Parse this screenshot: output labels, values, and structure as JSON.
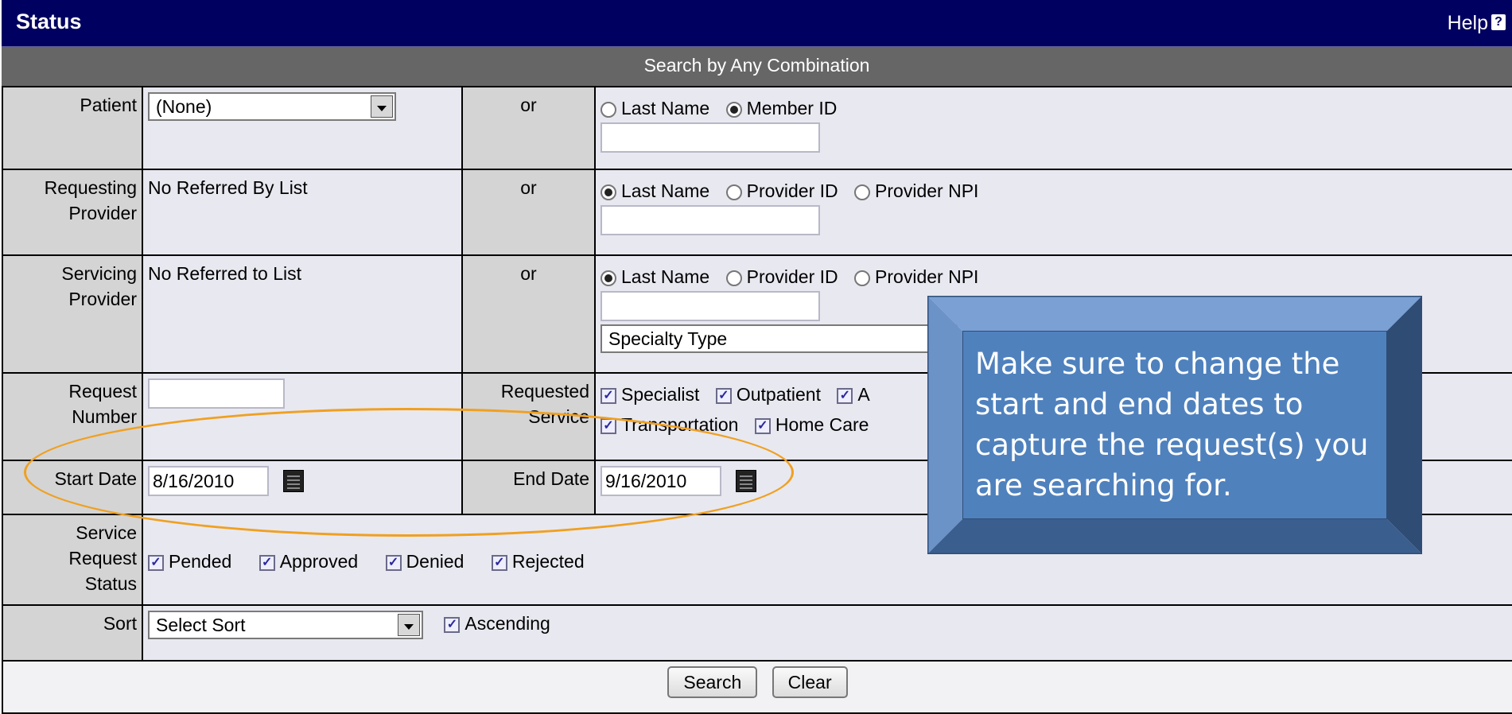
{
  "header": {
    "title": "Status",
    "help_label": "Help",
    "help_icon": "?"
  },
  "subheader": {
    "text": "Search by Any Combination"
  },
  "rows": {
    "patient": {
      "label": "Patient",
      "select_value": "(None)",
      "or": "or",
      "radios": [
        "Last Name",
        "Member ID"
      ],
      "selected": "Member ID"
    },
    "requesting": {
      "label_line1": "Requesting",
      "label_line2": "Provider",
      "value": "No Referred By List",
      "or": "or",
      "radios": [
        "Last Name",
        "Provider ID",
        "Provider NPI"
      ],
      "selected": "Last Name"
    },
    "servicing": {
      "label_line1": "Servicing",
      "label_line2": "Provider",
      "value": "No Referred to List",
      "or": "or",
      "radios": [
        "Last Name",
        "Provider ID",
        "Provider NPI"
      ],
      "selected": "Last Name",
      "specialty_placeholder": "Specialty Type"
    },
    "request_number": {
      "label_line1": "Request",
      "label_line2": "Number",
      "value": "",
      "service_label_line1": "Requested",
      "service_label_line2": "Service",
      "checks_line1": [
        "Specialist",
        "Outpatient",
        "A"
      ],
      "checks_line2": [
        "Transportation",
        "Home Care"
      ]
    },
    "dates": {
      "start_label": "Start Date",
      "start_value": "8/16/2010",
      "end_label": "End Date",
      "end_value": "9/16/2010"
    },
    "status": {
      "label_line1": "Service",
      "label_line2": "Request",
      "label_line3": "Status",
      "checks": [
        "Pended",
        "Approved",
        "Denied",
        "Rejected"
      ]
    },
    "sort": {
      "label": "Sort",
      "select_value": "Select Sort",
      "ascending_label": "Ascending"
    }
  },
  "buttons": {
    "search": "Search",
    "clear": "Clear"
  },
  "callout": {
    "text": "Make sure to change the start and end dates to capture the request(s) you are searching for."
  },
  "colors": {
    "title_bar": "#000060",
    "subheader": "#666666",
    "callout": "#4f81bd",
    "highlight": "#f0a020"
  }
}
